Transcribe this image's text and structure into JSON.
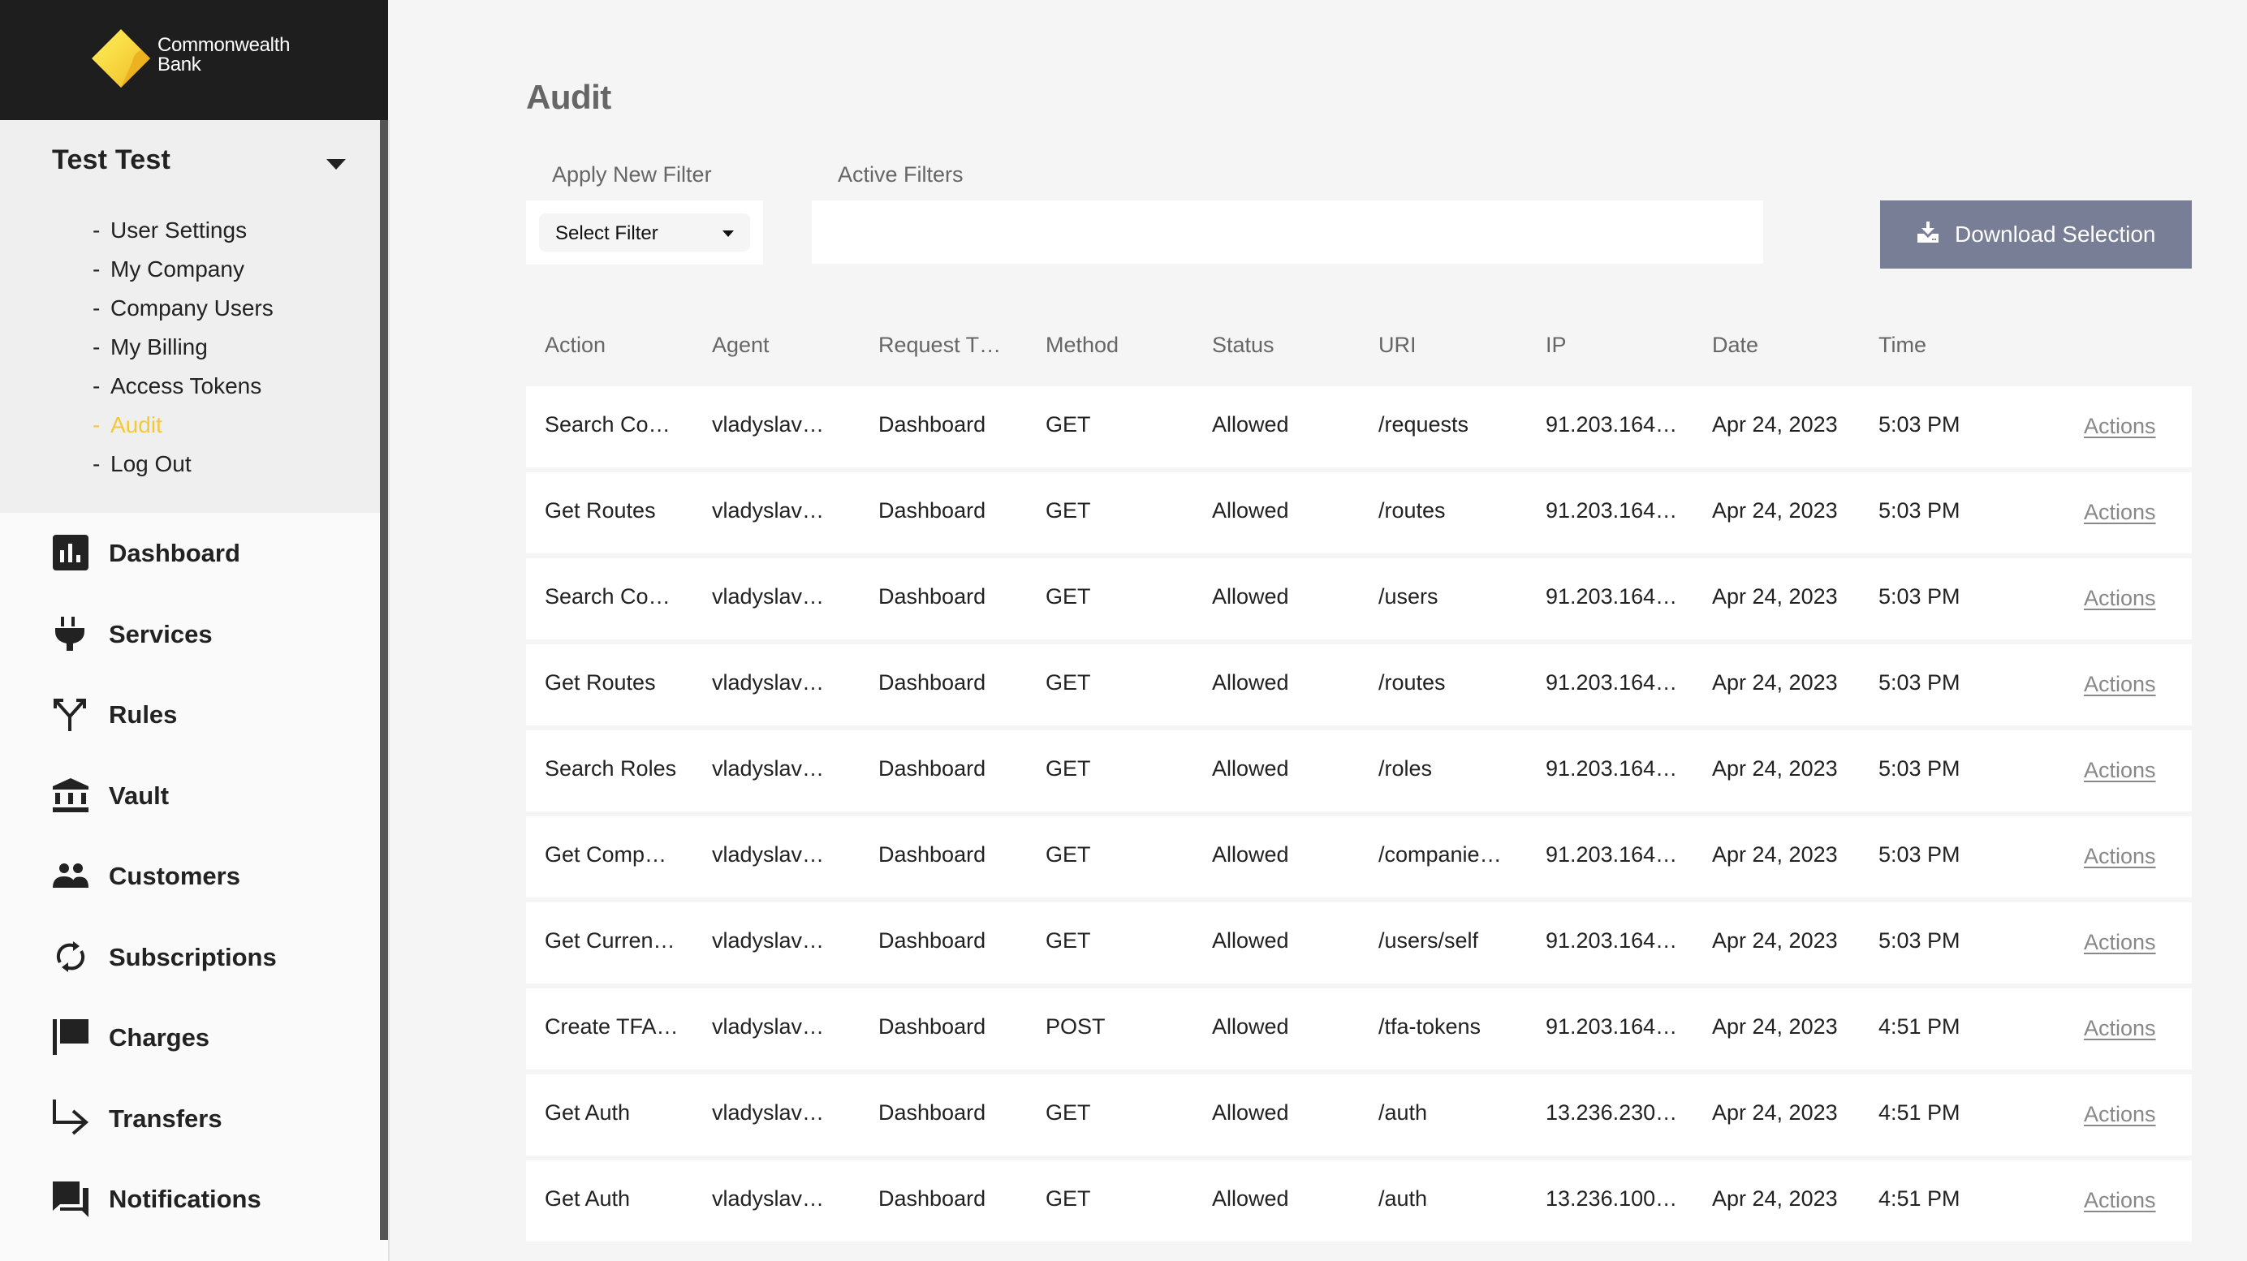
{
  "brand": {
    "name_line1": "Commonwealth",
    "name_line2": "Bank",
    "logo_icon": "cba-diamond-logo",
    "logo_color": "#f5c935"
  },
  "profile": {
    "name": "Test Test",
    "toggle_icon": "caret-down-icon",
    "menu": [
      {
        "label": "User Settings",
        "active": false
      },
      {
        "label": "My Company",
        "active": false
      },
      {
        "label": "Company Users",
        "active": false
      },
      {
        "label": "My Billing",
        "active": false
      },
      {
        "label": "Access Tokens",
        "active": false
      },
      {
        "label": "Audit",
        "active": true
      },
      {
        "label": "Log Out",
        "active": false
      }
    ],
    "active_color": "#f5c935"
  },
  "nav": [
    {
      "label": "Dashboard",
      "icon": "bar-chart-icon"
    },
    {
      "label": "Services",
      "icon": "plug-icon"
    },
    {
      "label": "Rules",
      "icon": "fork-arrows-icon"
    },
    {
      "label": "Vault",
      "icon": "bank-building-icon"
    },
    {
      "label": "Customers",
      "icon": "people-icon"
    },
    {
      "label": "Subscriptions",
      "icon": "sync-icon"
    },
    {
      "label": "Charges",
      "icon": "flag-icon"
    },
    {
      "label": "Transfers",
      "icon": "subdirectory-arrow-icon"
    },
    {
      "label": "Notifications",
      "icon": "chat-bubbles-icon"
    }
  ],
  "page": {
    "title": "Audit",
    "apply_filter_label": "Apply New Filter",
    "active_filters_label": "Active Filters",
    "select_filter_value": "Select Filter",
    "download_button": {
      "label": "Download Selection",
      "icon": "download-icon",
      "color": "#777e96"
    }
  },
  "table": {
    "columns": [
      "Action",
      "Agent",
      "Request T…",
      "Method",
      "Status",
      "URI",
      "IP",
      "Date",
      "Time"
    ],
    "row_action_label": "Actions",
    "rows": [
      [
        "Search Co…",
        "vladyslav…",
        "Dashboard",
        "GET",
        "Allowed",
        "/requests",
        "91.203.164…",
        "Apr 24, 2023",
        "5:03 PM"
      ],
      [
        "Get Routes",
        "vladyslav…",
        "Dashboard",
        "GET",
        "Allowed",
        "/routes",
        "91.203.164…",
        "Apr 24, 2023",
        "5:03 PM"
      ],
      [
        "Search Co…",
        "vladyslav…",
        "Dashboard",
        "GET",
        "Allowed",
        "/users",
        "91.203.164…",
        "Apr 24, 2023",
        "5:03 PM"
      ],
      [
        "Get Routes",
        "vladyslav…",
        "Dashboard",
        "GET",
        "Allowed",
        "/routes",
        "91.203.164…",
        "Apr 24, 2023",
        "5:03 PM"
      ],
      [
        "Search Roles",
        "vladyslav…",
        "Dashboard",
        "GET",
        "Allowed",
        "/roles",
        "91.203.164…",
        "Apr 24, 2023",
        "5:03 PM"
      ],
      [
        "Get Comp…",
        "vladyslav…",
        "Dashboard",
        "GET",
        "Allowed",
        "/companie…",
        "91.203.164…",
        "Apr 24, 2023",
        "5:03 PM"
      ],
      [
        "Get Curren…",
        "vladyslav…",
        "Dashboard",
        "GET",
        "Allowed",
        "/users/self",
        "91.203.164…",
        "Apr 24, 2023",
        "5:03 PM"
      ],
      [
        "Create TFA…",
        "vladyslav…",
        "Dashboard",
        "POST",
        "Allowed",
        "/tfa-tokens",
        "91.203.164…",
        "Apr 24, 2023",
        "4:51 PM"
      ],
      [
        "Get Auth",
        "vladyslav…",
        "Dashboard",
        "GET",
        "Allowed",
        "/auth",
        "13.236.230…",
        "Apr 24, 2023",
        "4:51 PM"
      ],
      [
        "Get Auth",
        "vladyslav…",
        "Dashboard",
        "GET",
        "Allowed",
        "/auth",
        "13.236.100…",
        "Apr 24, 2023",
        "4:51 PM"
      ]
    ]
  }
}
